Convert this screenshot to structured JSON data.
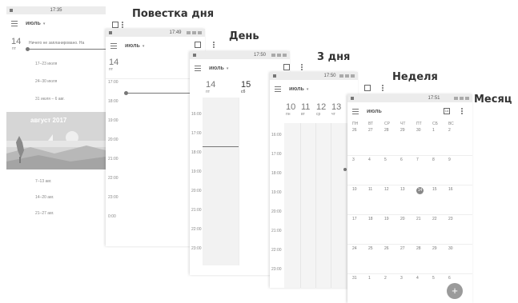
{
  "captions": {
    "agenda": "Повестка дня",
    "day": "День",
    "three_day": "3 дня",
    "week": "Неделя",
    "month": "Месяц"
  },
  "month_label": "июль",
  "agenda": {
    "time": "17:35",
    "day_number": "14",
    "day_name": "пт",
    "empty_text": "Ничего не запланировано. На",
    "weeks_before": [
      "17–23 июля",
      "24–30 июля",
      "31 июля – 6 авг."
    ],
    "banner_title": "август 2017",
    "weeks_after": [
      "7–13 авг.",
      "14–20 авг.",
      "21–27 авг."
    ]
  },
  "day": {
    "time": "17:49",
    "day_number": "14",
    "day_name": "пт",
    "hours": [
      "17:00",
      "18:00",
      "19:00",
      "20:00",
      "21:00",
      "22:00",
      "23:00",
      "0:00"
    ]
  },
  "three_day": {
    "time": "17:50",
    "days": [
      {
        "num": "14",
        "name": "пт"
      },
      {
        "num": "15",
        "name": "сб"
      }
    ],
    "hours": [
      "16:00",
      "17:00",
      "18:00",
      "19:00",
      "20:00",
      "21:00",
      "22:00",
      "23:00"
    ]
  },
  "week": {
    "time": "17:50",
    "days": [
      {
        "num": "10",
        "name": "пн"
      },
      {
        "num": "11",
        "name": "вт"
      },
      {
        "num": "12",
        "name": "ср"
      },
      {
        "num": "13",
        "name": "чт"
      }
    ],
    "hours": [
      "16:00",
      "17:00",
      "18:00",
      "19:00",
      "20:00",
      "21:00",
      "22:00",
      "23:00"
    ]
  },
  "month_view": {
    "time": "17:51",
    "weekday_headers": [
      "ПН",
      "ВТ",
      "СР",
      "ЧТ",
      "ПТ",
      "СБ",
      "ВС"
    ],
    "weeks": [
      [
        "26",
        "27",
        "28",
        "29",
        "30",
        "1",
        "2"
      ],
      [
        "3",
        "4",
        "5",
        "6",
        "7",
        "8",
        "9"
      ],
      [
        "10",
        "11",
        "12",
        "13",
        "14",
        "15",
        "16"
      ],
      [
        "17",
        "18",
        "19",
        "20",
        "21",
        "22",
        "23"
      ],
      [
        "24",
        "25",
        "26",
        "27",
        "28",
        "29",
        "30"
      ],
      [
        "31",
        "1",
        "2",
        "3",
        "4",
        "5",
        "6"
      ]
    ],
    "today": "14",
    "fab_label": "+"
  }
}
